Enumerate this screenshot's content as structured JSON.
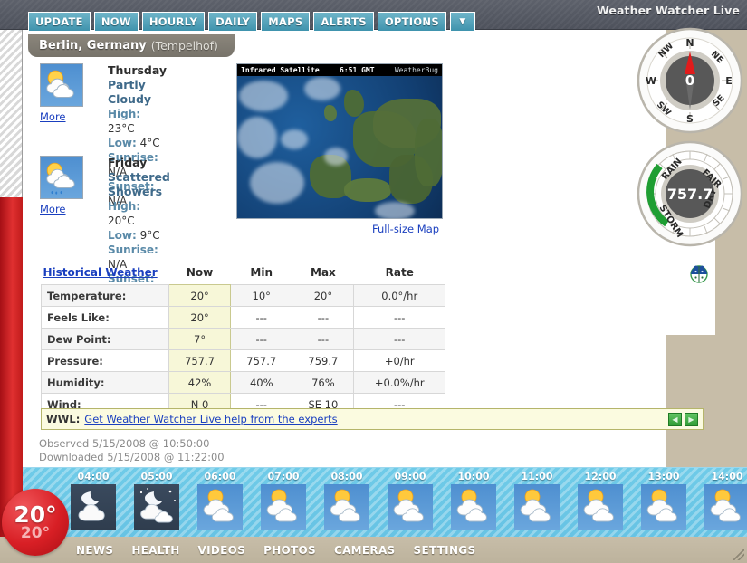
{
  "window": {
    "title": "Weather Watcher Live"
  },
  "toolbar": {
    "buttons": [
      {
        "label": "UPDATE",
        "name": "update"
      },
      {
        "label": "NOW",
        "name": "now"
      },
      {
        "label": "HOURLY",
        "name": "hourly"
      },
      {
        "label": "DAILY",
        "name": "daily"
      },
      {
        "label": "MAPS",
        "name": "maps"
      },
      {
        "label": "ALERTS",
        "name": "alerts"
      },
      {
        "label": "OPTIONS",
        "name": "options"
      }
    ],
    "more_arrow": "▼"
  },
  "location": {
    "city": "Berlin, Germany",
    "station": "(Tempelhof)"
  },
  "forecast": [
    {
      "day": "Thursday",
      "condition": "Partly Cloudy",
      "high_label": "High:",
      "high": "23°C",
      "low_label": "Low:",
      "low": "4°C",
      "sunrise_label": "Sunrise:",
      "sunrise": "N/A",
      "sunset_label": "Sunset:",
      "sunset": "N/A",
      "more": "More",
      "icon": "partly-cloudy-icon"
    },
    {
      "day": "Friday",
      "condition": "Scattered Showers",
      "high_label": "High:",
      "high": "20°C",
      "low_label": "Low:",
      "low": "9°C",
      "sunrise_label": "Sunrise:",
      "sunrise": "N/A",
      "sunset_label": "Sunset:",
      "sunset": "N/A",
      "more": "More",
      "icon": "scattered-showers-icon"
    }
  ],
  "satellite": {
    "title": "Infrared Satellite",
    "time": "6:51 GMT",
    "provider": "WeatherBug",
    "fullsize_link": "Full-size Map"
  },
  "conditions_table": {
    "historical_link": "Historical Weather",
    "columns": [
      "Now",
      "Min",
      "Max",
      "Rate"
    ],
    "rows": [
      {
        "label": "Temperature:",
        "now": "20°",
        "min": "10°",
        "max": "20°",
        "rate": "0.0°/hr"
      },
      {
        "label": "Feels Like:",
        "now": "20°",
        "min": "---",
        "max": "---",
        "rate": "---"
      },
      {
        "label": "Dew Point:",
        "now": "7°",
        "min": "---",
        "max": "---",
        "rate": "---"
      },
      {
        "label": "Pressure:",
        "now": "757.7",
        "min": "757.7",
        "max": "759.7",
        "rate": "+0/hr"
      },
      {
        "label": "Humidity:",
        "now": "42%",
        "min": "40%",
        "max": "76%",
        "rate": "+0.0%/hr"
      },
      {
        "label": "Wind:",
        "now": "N 0",
        "min": "---",
        "max": "SE 10",
        "rate": "---"
      }
    ]
  },
  "wwl_banner": {
    "label": "WWL:",
    "link": "Get Weather Watcher Live help from the experts",
    "prev": "◀",
    "next": "▶"
  },
  "timestamps": {
    "observed": "Observed 5/15/2008 @ 10:50:00",
    "downloaded": "Downloaded 5/15/2008 @ 11:22:00"
  },
  "hourly": [
    {
      "time": "04:00",
      "icon": "night-cloudy-icon",
      "night": true
    },
    {
      "time": "05:00",
      "icon": "night-partly-cloudy-icon",
      "night": true
    },
    {
      "time": "06:00",
      "icon": "partly-cloudy-icon",
      "night": false
    },
    {
      "time": "07:00",
      "icon": "partly-cloudy-icon",
      "night": false
    },
    {
      "time": "08:00",
      "icon": "partly-cloudy-icon",
      "night": false
    },
    {
      "time": "09:00",
      "icon": "partly-cloudy-icon",
      "night": false
    },
    {
      "time": "10:00",
      "icon": "partly-cloudy-icon",
      "night": false
    },
    {
      "time": "11:00",
      "icon": "partly-cloudy-icon",
      "night": false
    },
    {
      "time": "12:00",
      "icon": "partly-cloudy-icon",
      "night": false
    },
    {
      "time": "13:00",
      "icon": "partly-cloudy-icon",
      "night": false
    },
    {
      "time": "14:00",
      "icon": "partly-cloudy-icon",
      "night": false
    }
  ],
  "bottom_nav": [
    {
      "label": "NEWS",
      "name": "news"
    },
    {
      "label": "HEALTH",
      "name": "health"
    },
    {
      "label": "VIDEOS",
      "name": "videos"
    },
    {
      "label": "PHOTOS",
      "name": "photos"
    },
    {
      "label": "CAMERAS",
      "name": "cameras"
    },
    {
      "label": "SETTINGS",
      "name": "settings"
    }
  ],
  "temp_badge": {
    "current": "20°",
    "secondary": "20°"
  },
  "compass": {
    "value": "0",
    "directions": [
      "N",
      "NE",
      "E",
      "SE",
      "S",
      "SW",
      "W",
      "NW"
    ],
    "needle_direction": "N"
  },
  "barometer": {
    "value": "757.7",
    "labels": [
      "RAIN",
      "FAIR",
      "DRY",
      "STORM"
    ],
    "arc_color": "#1f9e33"
  },
  "colors": {
    "accent": "#3f93ad",
    "title_bar": "#5d616b",
    "tan": "#c7bda8",
    "red": "#d81f25",
    "hourly_blue": "#6fcbe8",
    "highlight_yellow": "#f7f7d8"
  }
}
